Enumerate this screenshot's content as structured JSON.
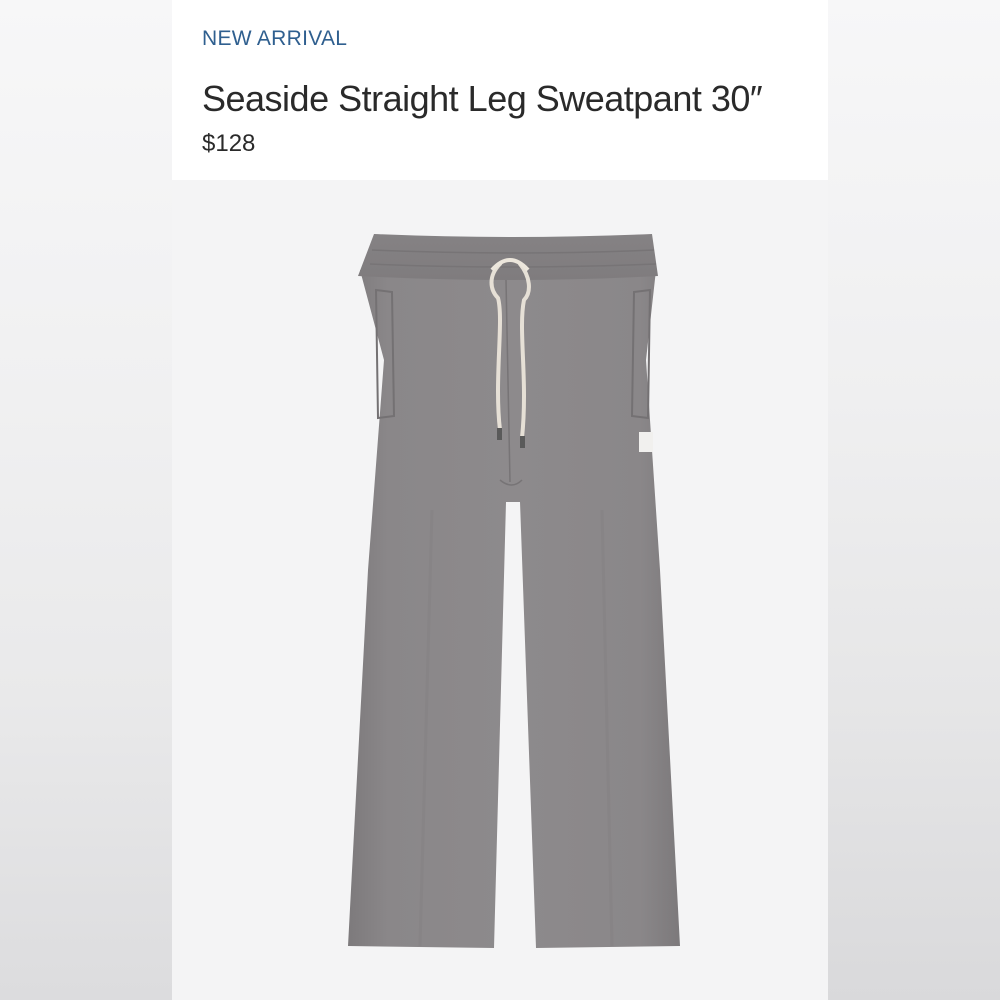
{
  "product": {
    "badge": "NEW ARRIVAL",
    "title": "Seaside Straight Leg Sweatpant 30″",
    "price": "$128",
    "image_alt": "gray-sweatpant-product-image"
  },
  "colors": {
    "badge": "#2f5f8f",
    "text": "#2a2a2a",
    "pant": "#8a8789",
    "background": "#f4f4f5"
  }
}
